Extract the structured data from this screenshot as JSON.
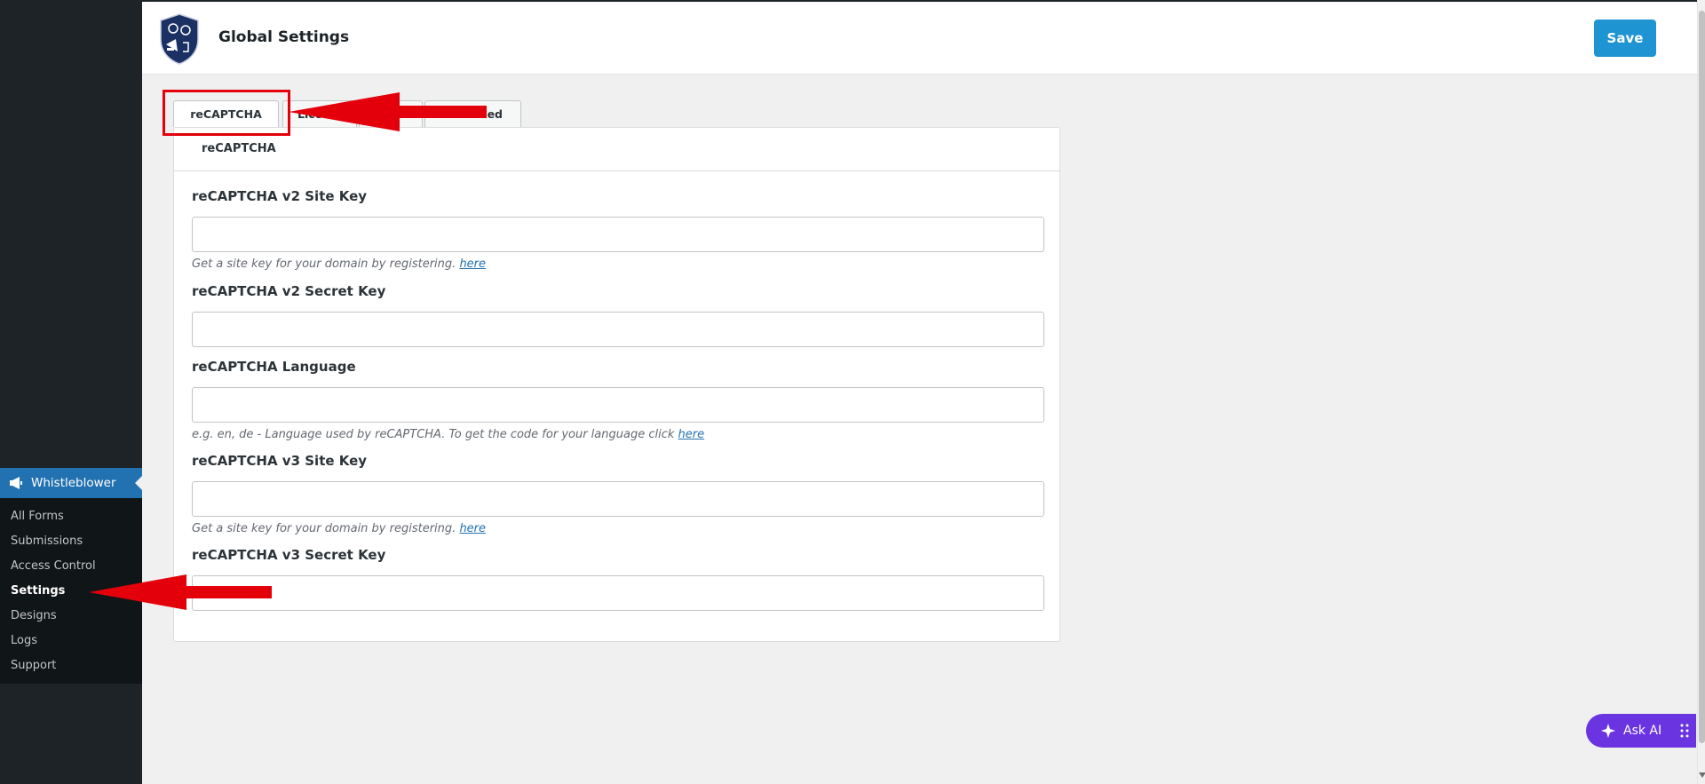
{
  "header": {
    "title": "Global Settings",
    "save_label": "Save",
    "logo_icon": "shield-logo-icon"
  },
  "sidebar": {
    "menu_label": "Whistleblower",
    "menu_icon": "megaphone-icon",
    "items": [
      {
        "label": "All Forms"
      },
      {
        "label": "Submissions"
      },
      {
        "label": "Access Control"
      },
      {
        "label": "Settings",
        "current": true
      },
      {
        "label": "Designs"
      },
      {
        "label": "Logs"
      },
      {
        "label": "Support"
      }
    ]
  },
  "tabs": [
    {
      "label": "reCAPTCHA",
      "active": true
    },
    {
      "label": "Lice"
    },
    {
      "label": ""
    },
    {
      "label": "ed"
    }
  ],
  "panel": {
    "heading": "reCAPTCHA",
    "fields": [
      {
        "label": "reCAPTCHA v2 Site Key",
        "value": "",
        "help": "Get a site key for your domain by registering.",
        "link": "here"
      },
      {
        "label": "reCAPTCHA v2 Secret Key",
        "value": ""
      },
      {
        "label": "reCAPTCHA Language",
        "value": "",
        "help": "e.g. en, de - Language used by reCAPTCHA. To get the code for your language click",
        "link": "here"
      },
      {
        "label": "reCAPTCHA v3 Site Key",
        "value": "",
        "help": "Get a site key for your domain by registering.",
        "link": "here"
      },
      {
        "label": "reCAPTCHA v3 Secret Key",
        "value": ""
      }
    ]
  },
  "ask_ai": {
    "label": "Ask AI"
  },
  "colors": {
    "accent": "#2271b1",
    "save": "#1f94d2",
    "annotation": "#e3000b",
    "ask_ai": "#6a35e0"
  }
}
